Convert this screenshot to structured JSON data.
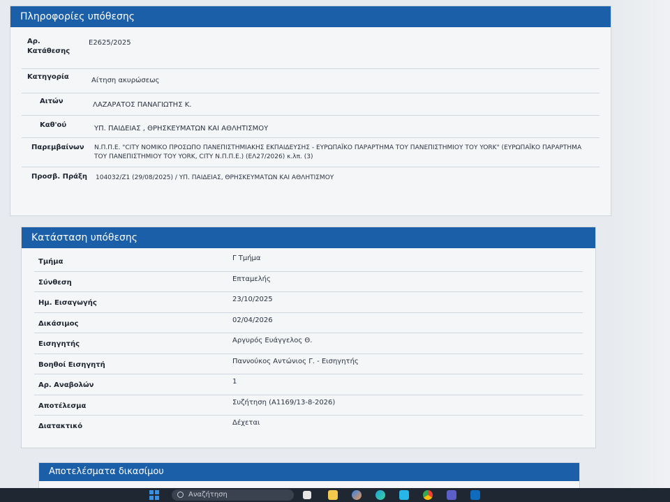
{
  "case_info": {
    "title": "Πληροφορίες υπόθεσης",
    "rows": [
      {
        "label": "Αρ. Κατάθεσης",
        "value": "Ε2625/2025"
      },
      {
        "label": "Κατηγορία",
        "value": "Αίτηση ακυρώσεως"
      },
      {
        "label": "Αιτών",
        "value": "ΛΑΖΑΡΑΤΟΣ ΠΑΝΑΓΙΩΤΗΣ Κ."
      },
      {
        "label": "Καθ'ού",
        "value": "ΥΠ. ΠΑΙΔΕΙΑΣ , ΘΡΗΣΚΕΥΜΑΤΩΝ ΚΑΙ ΑΘΛΗΤΙΣΜΟΥ"
      },
      {
        "label": "Παρεμβαίνων",
        "value": "Ν.Π.Π.Ε. \"CITY ΝΟΜΙΚΟ ΠΡΟΣΩΠΟ ΠΑΝΕΠΙΣΤΗΜΙΑΚΗΣ ΕΚΠΑΙΔΕΥΣΗΣ - ΕΥΡΩΠΑΪΚΟ ΠΑΡΑΡΤΗΜΑ ΤΟΥ ΠΑΝΕΠΙΣΤΗΜΙΟΥ ΤΟΥ YORK\" (ΕΥΡΩΠΑΪΚΟ ΠΑΡΑΡΤΗΜΑ ΤΟΥ ΠΑΝΕΠΙΣΤΗΜΙΟΥ ΤΟΥ YORK, CITY Ν.Π.Π.Ε.) (ΕΛ27/2026) κ.λπ. (3)"
      },
      {
        "label": "Προσβ. Πράξη",
        "value": "104032/Ζ1 (29/08/2025) / ΥΠ. ΠΑΙΔΕΙΑΣ, ΘΡΗΣΚΕΥΜΑΤΩΝ ΚΑΙ ΑΘΛΗΤΙΣΜΟΥ"
      }
    ]
  },
  "case_status": {
    "title": "Κατάσταση υπόθεσης",
    "rows": [
      {
        "label": "Τμήμα",
        "value": "Γ Τμήμα"
      },
      {
        "label": "Σύνθεση",
        "value": "Επταμελής"
      },
      {
        "label": "Ημ. Εισαγωγής",
        "value": "23/10/2025"
      },
      {
        "label": "Δικάσιμος",
        "value": "02/04/2026"
      },
      {
        "label": "Εισηγητής",
        "value": "Αργυρός Ευάγγελος Θ."
      },
      {
        "label": "Βοηθοί Εισηγητή",
        "value": "Παννούκος Αντώνιος Γ. - Εισηγητής"
      },
      {
        "label": "Αρ. Αναβολών",
        "value": "1"
      },
      {
        "label": "Αποτέλεσμα",
        "value": "Συζήτηση (Α1169/13-8-2026)"
      },
      {
        "label": "Διατακτικό",
        "value": "Δέχεται"
      }
    ]
  },
  "hearing_results": {
    "title": "Αποτελέσματα δικασίμου"
  },
  "taskbar": {
    "search_label": "Αναζήτηση",
    "icons": [
      "start-icon",
      "search-icon",
      "task-view-icon",
      "file-explorer-icon",
      "copilot-icon",
      "edge-icon",
      "store-icon",
      "chrome-icon",
      "teams-icon",
      "outlook-icon"
    ]
  },
  "colors": {
    "header_blue": "#1a5fa8",
    "panel_bg": "#f4f6f8"
  }
}
